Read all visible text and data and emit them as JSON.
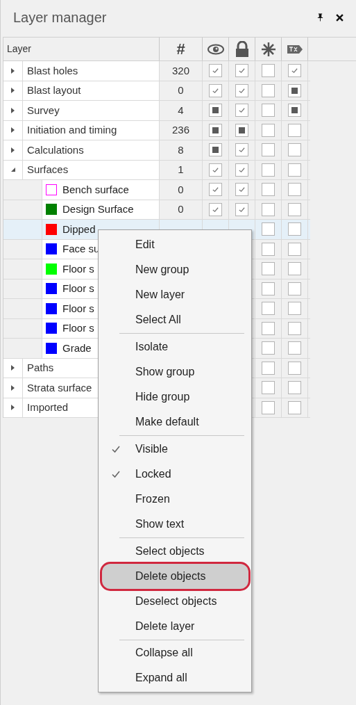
{
  "panel": {
    "title": "Layer manager"
  },
  "columns": [
    {
      "label": "Layer"
    },
    {
      "label": "#"
    }
  ],
  "layers": [
    {
      "name": "Blast holes",
      "count": "320",
      "expanded": false,
      "visible": {
        "checked": true,
        "mixed": false
      },
      "locked": {
        "checked": true,
        "mixed": false
      },
      "frozen": {
        "checked": false,
        "mixed": false
      },
      "show_text": {
        "checked": true,
        "mixed": false
      }
    },
    {
      "name": "Blast layout",
      "count": "0",
      "expanded": false,
      "visible": {
        "checked": true,
        "mixed": false
      },
      "locked": {
        "checked": true,
        "mixed": false
      },
      "frozen": {
        "checked": false,
        "mixed": false
      },
      "show_text": {
        "checked": true,
        "mixed": true
      }
    },
    {
      "name": "Survey",
      "count": "4",
      "expanded": false,
      "visible": {
        "checked": true,
        "mixed": true
      },
      "locked": {
        "checked": true,
        "mixed": false
      },
      "frozen": {
        "checked": false,
        "mixed": false
      },
      "show_text": {
        "checked": true,
        "mixed": true
      }
    },
    {
      "name": "Initiation and timing",
      "count": "236",
      "expanded": false,
      "visible": {
        "checked": true,
        "mixed": true
      },
      "locked": {
        "checked": true,
        "mixed": true
      },
      "frozen": {
        "checked": false,
        "mixed": false
      },
      "show_text": {
        "checked": false,
        "mixed": false
      }
    },
    {
      "name": "Calculations",
      "count": "8",
      "expanded": false,
      "visible": {
        "checked": true,
        "mixed": true
      },
      "locked": {
        "checked": true,
        "mixed": false
      },
      "frozen": {
        "checked": false,
        "mixed": false
      },
      "show_text": {
        "checked": false,
        "mixed": false
      }
    },
    {
      "name": "Surfaces",
      "count": "1",
      "expanded": true,
      "visible": {
        "checked": true,
        "mixed": false
      },
      "locked": {
        "checked": true,
        "mixed": false
      },
      "frozen": {
        "checked": false,
        "mixed": false
      },
      "show_text": {
        "checked": false,
        "mixed": false
      },
      "children": [
        {
          "name": "Bench surface",
          "color": "#ff00ff",
          "filled": false,
          "count": "0",
          "selected": false,
          "visible": {
            "checked": true,
            "mixed": false
          },
          "locked": {
            "checked": true,
            "mixed": false
          },
          "frozen": {
            "checked": false,
            "mixed": false
          },
          "show_text": {
            "checked": false,
            "mixed": false
          }
        },
        {
          "name": "Design Surface",
          "color": "#008000",
          "filled": true,
          "count": "0",
          "selected": false,
          "visible": {
            "checked": true,
            "mixed": false
          },
          "locked": {
            "checked": true,
            "mixed": false
          },
          "frozen": {
            "checked": false,
            "mixed": false
          },
          "show_text": {
            "checked": false,
            "mixed": false
          }
        },
        {
          "name": "Dipped",
          "color": "#ff0000",
          "filled": true,
          "selected": true,
          "frozen": {
            "checked": false,
            "mixed": false
          },
          "show_text": {
            "checked": false,
            "mixed": false
          }
        },
        {
          "name": "Face su",
          "color": "#0000ff",
          "filled": true,
          "selected": false,
          "frozen": {
            "checked": false,
            "mixed": false
          },
          "show_text": {
            "checked": false,
            "mixed": false
          }
        },
        {
          "name": "Floor s",
          "color": "#00ff00",
          "filled": true,
          "selected": false,
          "frozen": {
            "checked": false,
            "mixed": false
          },
          "show_text": {
            "checked": false,
            "mixed": false
          }
        },
        {
          "name": "Floor s",
          "color": "#0000ff",
          "filled": true,
          "selected": false,
          "frozen": {
            "checked": false,
            "mixed": false
          },
          "show_text": {
            "checked": false,
            "mixed": false
          }
        },
        {
          "name": "Floor s",
          "color": "#0000ff",
          "filled": true,
          "selected": false,
          "frozen": {
            "checked": false,
            "mixed": false
          },
          "show_text": {
            "checked": false,
            "mixed": false
          }
        },
        {
          "name": "Floor s",
          "color": "#0000ff",
          "filled": true,
          "selected": false,
          "frozen": {
            "checked": false,
            "mixed": false
          },
          "show_text": {
            "checked": false,
            "mixed": false
          }
        },
        {
          "name": "Grade",
          "color": "#0000ff",
          "filled": true,
          "selected": false,
          "frozen": {
            "checked": false,
            "mixed": false
          },
          "show_text": {
            "checked": false,
            "mixed": false
          }
        }
      ]
    },
    {
      "name": "Paths",
      "expanded": false,
      "frozen": {
        "checked": false,
        "mixed": false
      },
      "show_text": {
        "checked": false,
        "mixed": false
      }
    },
    {
      "name": "Strata surface",
      "expanded": false,
      "frozen": {
        "checked": false,
        "mixed": false
      },
      "show_text": {
        "checked": false,
        "mixed": false
      }
    },
    {
      "name": "Imported",
      "expanded": false,
      "frozen": {
        "checked": false,
        "mixed": false
      },
      "show_text": {
        "checked": false,
        "mixed": false
      }
    }
  ],
  "context_menu": {
    "groups": [
      [
        {
          "label": "Edit",
          "checked": false,
          "highlighted": false
        },
        {
          "label": "New group",
          "checked": false,
          "highlighted": false
        },
        {
          "label": "New layer",
          "checked": false,
          "highlighted": false
        },
        {
          "label": "Select All",
          "checked": false,
          "highlighted": false
        }
      ],
      [
        {
          "label": "Isolate",
          "checked": false,
          "highlighted": false
        },
        {
          "label": "Show group",
          "checked": false,
          "highlighted": false
        },
        {
          "label": "Hide group",
          "checked": false,
          "highlighted": false
        },
        {
          "label": "Make default",
          "checked": false,
          "highlighted": false
        }
      ],
      [
        {
          "label": "Visible",
          "checked": true,
          "highlighted": false
        },
        {
          "label": "Locked",
          "checked": true,
          "highlighted": false
        },
        {
          "label": "Frozen",
          "checked": false,
          "highlighted": false
        },
        {
          "label": "Show text",
          "checked": false,
          "highlighted": false
        }
      ],
      [
        {
          "label": "Select objects",
          "checked": false,
          "highlighted": false
        },
        {
          "label": "Delete objects",
          "checked": false,
          "highlighted": true
        },
        {
          "label": "Deselect objects",
          "checked": false,
          "highlighted": false
        },
        {
          "label": "Delete layer",
          "checked": false,
          "highlighted": false
        }
      ],
      [
        {
          "label": "Collapse all",
          "checked": false,
          "highlighted": false
        },
        {
          "label": "Expand all",
          "checked": false,
          "highlighted": false
        }
      ]
    ]
  }
}
